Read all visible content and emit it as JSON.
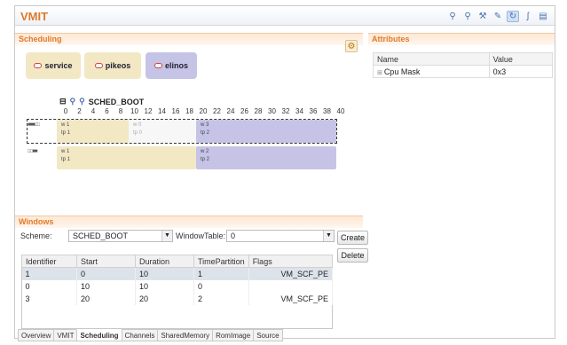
{
  "app": {
    "title": "VMIT"
  },
  "toolbar": {
    "icons": [
      "zoom-in-icon",
      "zoom-out-icon",
      "tools-icon",
      "edit-icon",
      "sync-icon",
      "chart-icon",
      "export-icon"
    ]
  },
  "scheduling": {
    "title": "Scheduling",
    "legend": [
      {
        "label": "service",
        "color": "#f3e8c4"
      },
      {
        "label": "pikeos",
        "color": "#f3e8c4"
      },
      {
        "label": "elinos",
        "color": "#c6c4e6"
      }
    ],
    "schedule_name": "SCHED_BOOT",
    "timeline_ticks": [
      "0",
      "2",
      "4",
      "6",
      "8",
      "10",
      "12",
      "14",
      "16",
      "18",
      "20",
      "22",
      "24",
      "26",
      "28",
      "30",
      "32",
      "34",
      "36",
      "38",
      "40"
    ],
    "rows": [
      {
        "marker": "■■■□□",
        "slots": [
          {
            "w": "w 1",
            "tp": "tp 1",
            "kind": "service"
          },
          {
            "w": "w 0",
            "tp": "tp 0",
            "kind": "empty"
          },
          {
            "w": "w 3",
            "tp": "tp 2",
            "kind": "elinos"
          }
        ]
      },
      {
        "marker": "□□■■",
        "slots": [
          {
            "w": "w 1",
            "tp": "tp 1",
            "kind": "service"
          },
          {
            "w": "w 2",
            "tp": "tp 2",
            "kind": "elinos"
          }
        ]
      }
    ]
  },
  "attributes": {
    "title": "Attributes",
    "headers": [
      "Name",
      "Value"
    ],
    "rows": [
      {
        "name": "Cpu Mask",
        "value": "0x3"
      }
    ]
  },
  "windows": {
    "title": "Windows",
    "scheme_label": "Scheme:",
    "scheme_value": "SCHED_BOOT",
    "windowtable_label": "WindowTable:",
    "windowtable_value": "0",
    "create_label": "Create",
    "delete_label": "Delete",
    "headers": [
      "Identifier",
      "Start",
      "Duration",
      "TimePartition",
      "Flags"
    ],
    "rows": [
      [
        "1",
        "0",
        "10",
        "1",
        "VM_SCF_PE"
      ],
      [
        "0",
        "10",
        "10",
        "0",
        ""
      ],
      [
        "3",
        "20",
        "20",
        "2",
        "VM_SCF_PE"
      ]
    ]
  },
  "tabs": [
    "Overview",
    "VMIT",
    "Scheduling",
    "Channels",
    "SharedMemory",
    "RomImage",
    "Source"
  ],
  "active_tab": "Scheduling"
}
